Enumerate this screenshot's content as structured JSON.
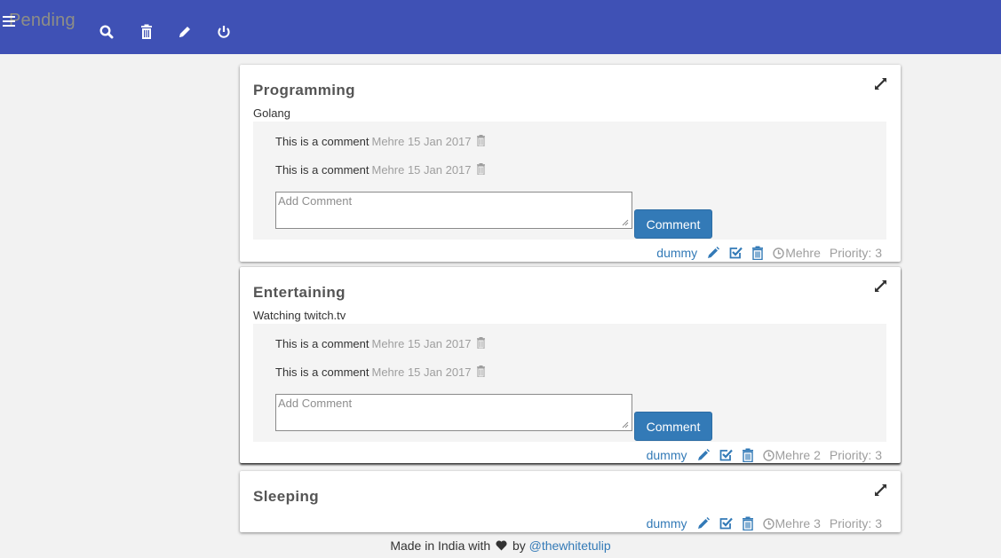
{
  "header": {
    "title": "Pending",
    "background": "#3f51b5",
    "icons": [
      "menu-icon",
      "search-icon",
      "trash-icon",
      "pencil-icon",
      "power-icon"
    ]
  },
  "tasks": [
    {
      "title": "Programming",
      "description": "Golang",
      "comments": [
        {
          "text": "This is a comment",
          "meta": "Mehre 15 Jan 2017"
        },
        {
          "text": "This is a comment",
          "meta": "Mehre 15 Jan 2017"
        }
      ],
      "comment_placeholder": "Add Comment",
      "comment_button": "Comment",
      "tag": "dummy",
      "owner": "Mehre",
      "priority": "Priority: 3"
    },
    {
      "title": "Entertaining",
      "description": "Watching twitch.tv",
      "comments": [
        {
          "text": "This is a comment",
          "meta": "Mehre 15 Jan 2017"
        },
        {
          "text": "This is a comment",
          "meta": "Mehre 15 Jan 2017"
        }
      ],
      "comment_placeholder": "Add Comment",
      "comment_button": "Comment",
      "tag": "dummy",
      "owner": "Mehre 2",
      "priority": "Priority: 3"
    },
    {
      "title": "Sleeping",
      "tag": "dummy",
      "owner": "Mehre 3",
      "priority": "Priority: 3"
    }
  ],
  "footer": {
    "prefix": "Made in India with",
    "by": "by",
    "link": "@thewhitetulip"
  },
  "colors": {
    "accent": "#337ab7",
    "muted": "#9e9e9e"
  }
}
